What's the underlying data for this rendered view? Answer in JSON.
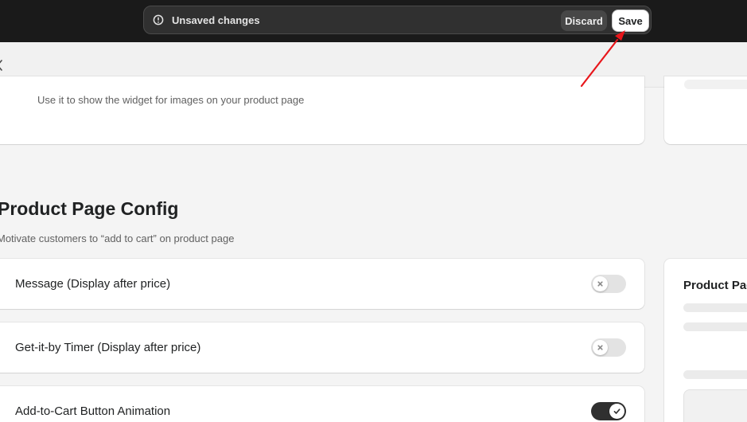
{
  "savebar": {
    "message": "Unsaved changes",
    "discard_label": "Discard",
    "save_label": "Save",
    "warning_icon": "alert-circle-icon"
  },
  "widget_card": {
    "description": "Use it to show the widget for images on your product page"
  },
  "section": {
    "title": "Product Page Config",
    "subtitle": "Motivate customers to “add to cart” on product page"
  },
  "settings": [
    {
      "label": "Message (Display after price)",
      "enabled": false
    },
    {
      "label": "Get-it-by Timer (Display after price)",
      "enabled": false
    },
    {
      "label": "Add-to-Cart Button Animation",
      "enabled": true
    }
  ],
  "preview": {
    "title": "Product Page"
  },
  "colors": {
    "topbar": "#1a1a1a",
    "annotation_arrow": "#e8161b",
    "toggle_on": "#303030",
    "toggle_off": "#e3e3e3"
  }
}
